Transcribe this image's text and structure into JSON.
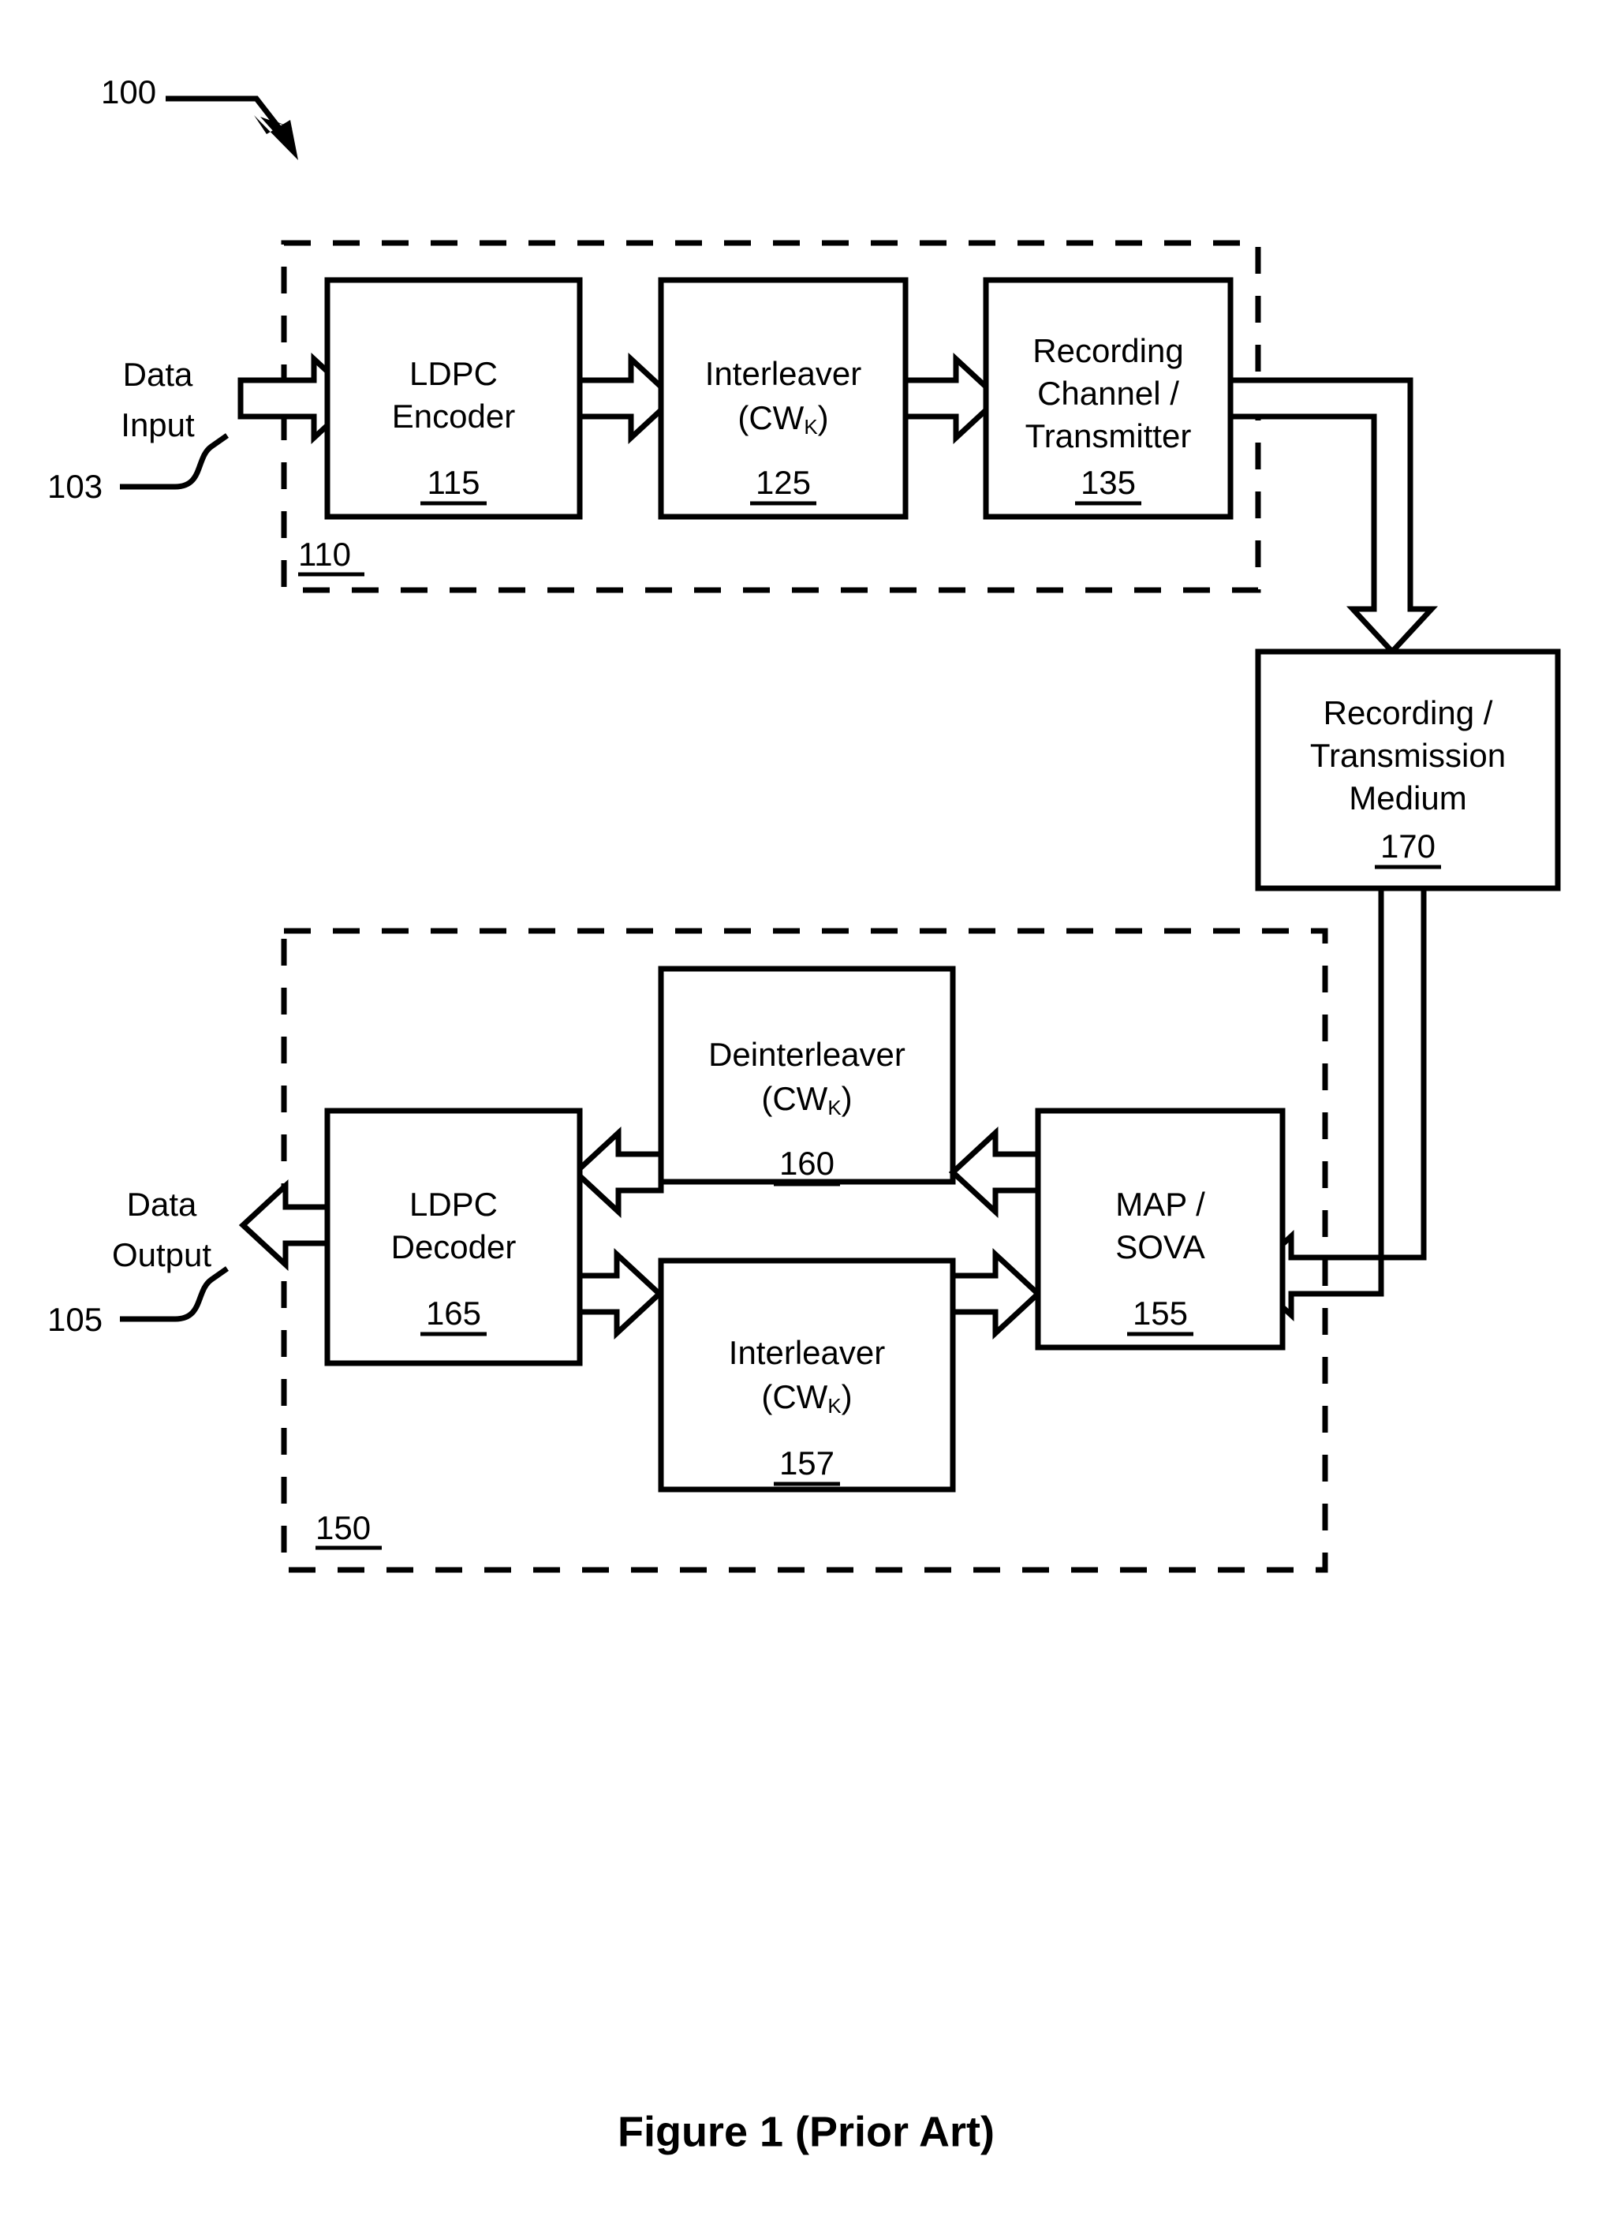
{
  "figure": {
    "caption": "Figure 1 (Prior Art)",
    "system_ref": "100"
  },
  "io": {
    "input_line1": "Data",
    "input_line2": "Input",
    "input_ref": "103",
    "output_line1": "Data",
    "output_line2": "Output",
    "output_ref": "105"
  },
  "groups": {
    "transmit": {
      "ref": "110"
    },
    "receive": {
      "ref": "150"
    }
  },
  "blocks": {
    "ldpc_encoder": {
      "line1": "LDPC",
      "line2": "Encoder",
      "ref": "115"
    },
    "interleaver_tx": {
      "line1": "Interleaver",
      "line2_pre": "(CW",
      "line2_sub": "K",
      "line2_post": ")",
      "ref": "125"
    },
    "recording_channel": {
      "line1": "Recording",
      "line2": "Channel /",
      "line3": "Transmitter",
      "ref": "135"
    },
    "medium": {
      "line1": "Recording /",
      "line2": "Transmission",
      "line3": "Medium",
      "ref": "170"
    },
    "deinterleaver": {
      "line1": "Deinterleaver",
      "line2_pre": "(CW",
      "line2_sub": "K",
      "line2_post": ")",
      "ref": "160"
    },
    "ldpc_decoder": {
      "line1": "LDPC",
      "line2": "Decoder",
      "ref": "165"
    },
    "interleaver_rx": {
      "line1": "Interleaver",
      "line2_pre": "(CW",
      "line2_sub": "K",
      "line2_post": ")",
      "ref": "157"
    },
    "map_sova": {
      "line1": "MAP /",
      "line2": "SOVA",
      "ref": "155"
    }
  },
  "colors": {
    "ink": "#000000",
    "paper": "#ffffff"
  }
}
